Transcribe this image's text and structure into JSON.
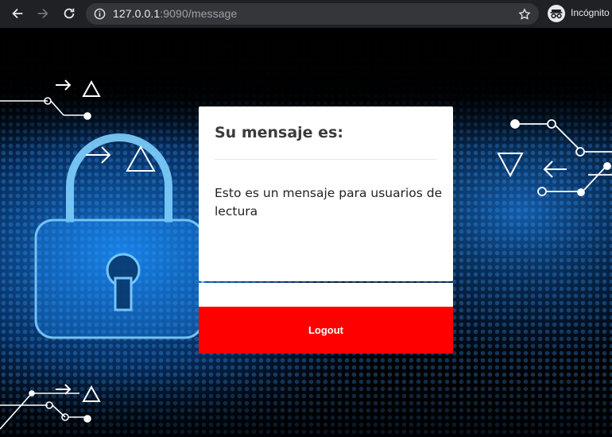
{
  "browser": {
    "url_host": "127.0.0.1",
    "url_path": ":9090/message",
    "incognito_label": "Incógnito",
    "icons": [
      "back-icon",
      "forward-icon",
      "reload-icon",
      "info-icon",
      "star-icon",
      "incognito-icon"
    ]
  },
  "card": {
    "title": "Su mensaje es:",
    "message": "Esto es un mensaje para usuarios de lectura"
  },
  "actions": {
    "logout_label": "Logout"
  },
  "colors": {
    "chrome_bg": "#202124",
    "omnibox_bg": "#35363a",
    "button_red": "#ff0000",
    "card_bg": "#ffffff",
    "glow_blue": "#1e90ff"
  }
}
